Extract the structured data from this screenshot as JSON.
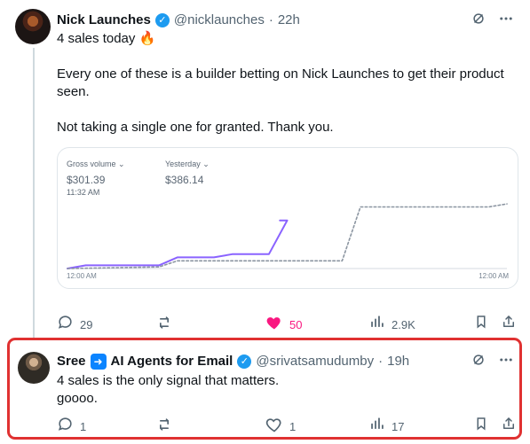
{
  "thread": {
    "main_post": {
      "author_name": "Nick Launches",
      "handle": "@nicklaunches",
      "separator": "·",
      "time": "22h",
      "text": "4 sales today 🔥\n\nEvery one of these is a builder betting on Nick Launches to get their product seen.\n\nNot taking a single one for granted. Thank you.",
      "actions": {
        "reply_count": "29",
        "repost_count": "",
        "like_count": "50",
        "views_count": "2.9K"
      }
    },
    "reply_post": {
      "author_name_part1": "Sree",
      "author_name_part2": "AI Agents for Email",
      "handle": "@srivatsamudumby",
      "separator": "·",
      "time": "19h",
      "text": "4 sales is the only signal that matters.\ngoooo.",
      "actions": {
        "reply_count": "1",
        "repost_count": "",
        "like_count": "1",
        "views_count": "17"
      }
    }
  },
  "chart_data": {
    "type": "line",
    "title": "",
    "xlabel": "",
    "ylabel": "",
    "metrics": {
      "gross_volume_label": "Gross volume ⌄",
      "gross_volume_value": "$301.39",
      "gross_volume_time": "11:32 AM",
      "yesterday_label": "Yesterday ⌄",
      "yesterday_value": "$386.14"
    },
    "x_ticks": [
      "12:00 AM",
      "12:00 AM"
    ],
    "ylim": [
      0,
      400
    ],
    "series": [
      {
        "name": "",
        "style": "solid",
        "color": "#8a63ff",
        "x": [
          0,
          1,
          5,
          6,
          8,
          9,
          11,
          12,
          11.6
        ],
        "y": [
          0,
          20,
          20,
          70,
          70,
          90,
          90,
          301.39,
          301.39
        ]
      },
      {
        "name": "",
        "style": "dashed",
        "color": "#8b95a1",
        "x": [
          0,
          5,
          6,
          15,
          16,
          23,
          24
        ],
        "y": [
          0,
          10,
          48,
          48,
          386.14,
          386.14,
          405
        ]
      }
    ]
  },
  "ui": {
    "verified_icon": "verified-badge-icon",
    "fire_icon": "fire-emoji",
    "arrow_icon": "arrow-right-badge-icon",
    "grok_icon": "grok-icon",
    "more_icon": "more-icon",
    "reply_icon": "reply-icon",
    "repost_icon": "repost-icon",
    "like_icon": "like-icon",
    "views_icon": "views-icon",
    "bookmark_icon": "bookmark-icon",
    "share_icon": "share-icon",
    "accent_blue": "#1d9bf0",
    "highlight_red": "#e03131"
  }
}
